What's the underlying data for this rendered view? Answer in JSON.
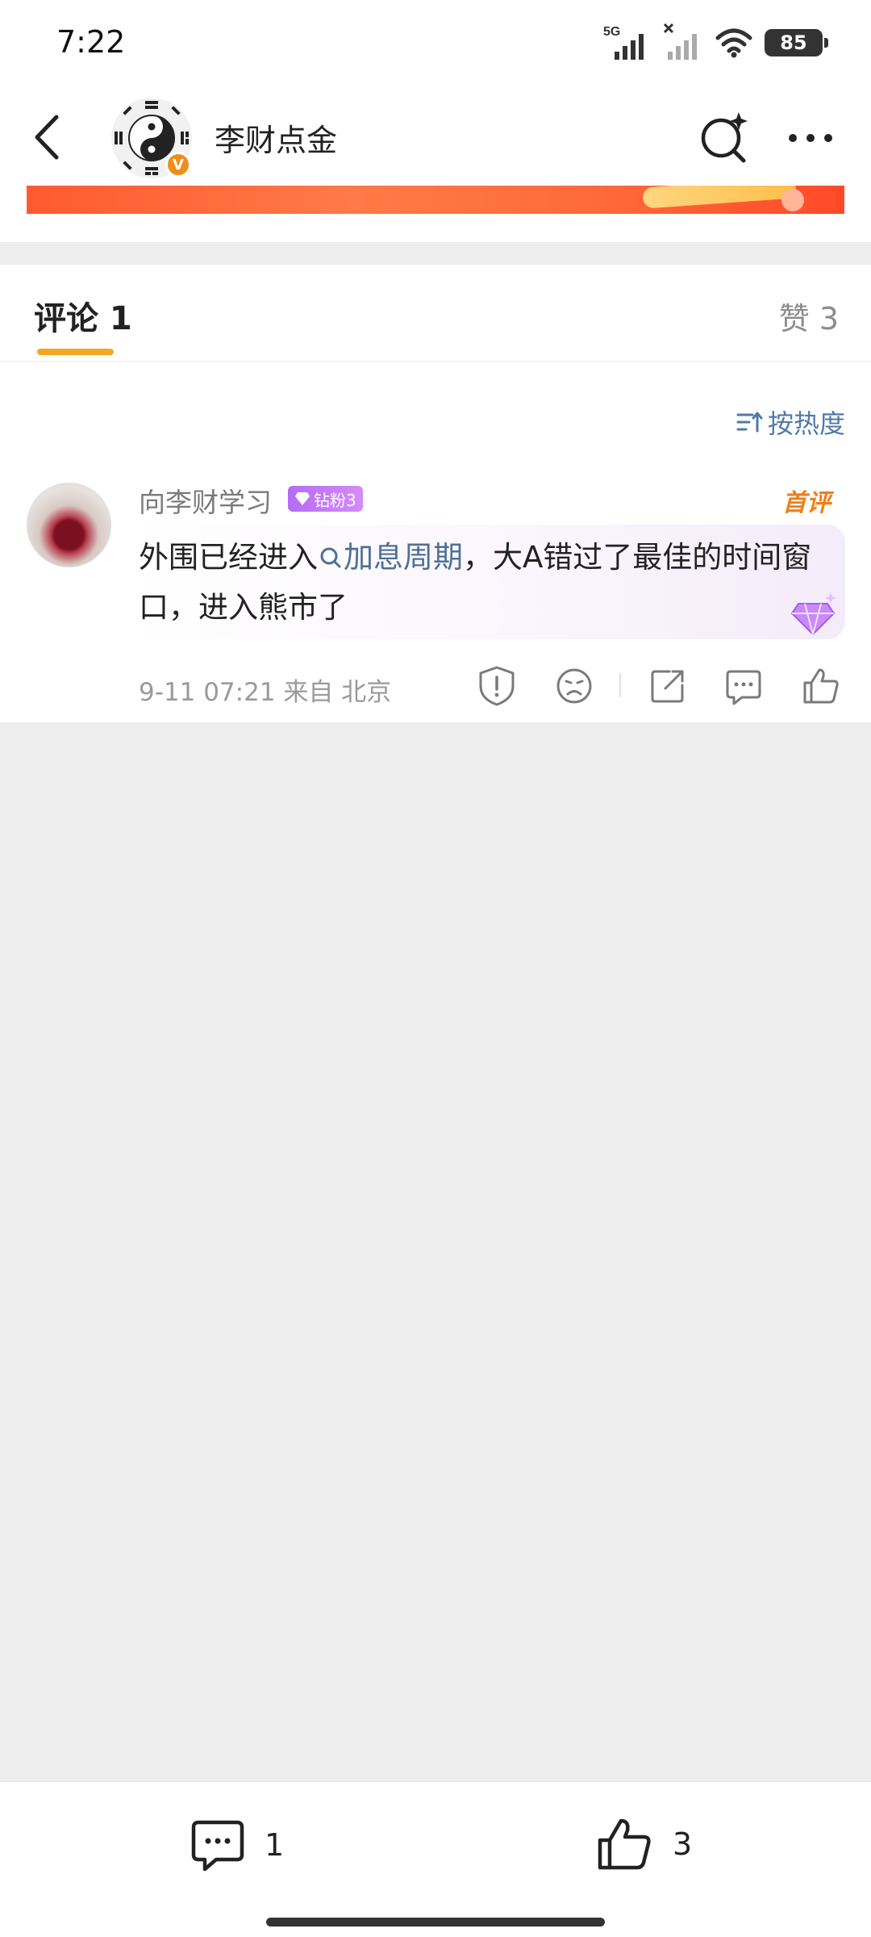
{
  "status_bar": {
    "time": "7:22",
    "battery": "85",
    "network": "5G"
  },
  "header": {
    "account_name": "李财点金",
    "verified_mark": "V"
  },
  "tabs": {
    "comments_label": "评论 1",
    "likes_label": "赞 3"
  },
  "sort": {
    "label": "按热度"
  },
  "comment": {
    "user_name": "向李财学习",
    "fan_badge": "钻粉3",
    "first_badge": "首评",
    "text_before": "外围已经进入",
    "topic": "加息周期",
    "text_after": "，大A错过了最佳的时间窗口，进入熊市了",
    "time": "9-11 07:21",
    "location": "来自 北京"
  },
  "bottom_bar": {
    "comment_count": "1",
    "like_count": "3"
  },
  "colors": {
    "accent": "#f5a623",
    "link": "#507aa8",
    "badge": "#b46cf5",
    "first": "#f07f16",
    "banner": "#ff5a32"
  }
}
